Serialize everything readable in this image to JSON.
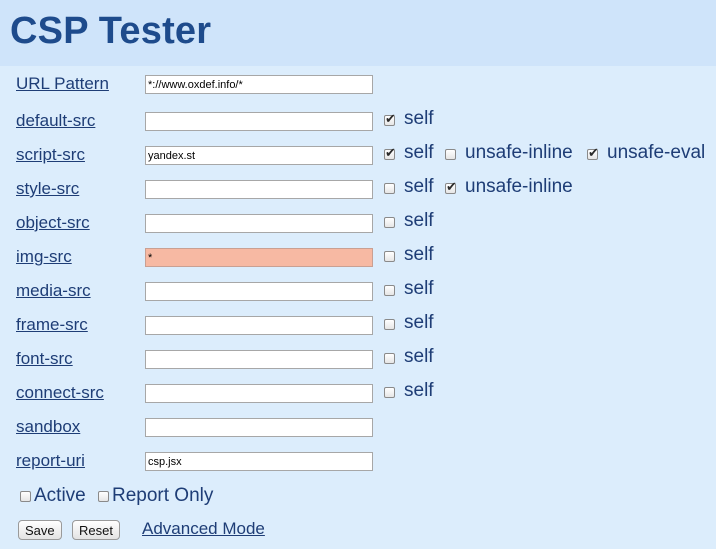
{
  "title": "CSP Tester",
  "rows": [
    {
      "label": "URL Pattern",
      "value": "*://www.oxdef.info/*"
    },
    {
      "label": "default-src",
      "value": "",
      "options": [
        {
          "label": "self",
          "checked": true
        }
      ]
    },
    {
      "label": "script-src",
      "value": "yandex.st",
      "options": [
        {
          "label": "self",
          "checked": true
        },
        {
          "label": "unsafe-inline",
          "checked": false
        },
        {
          "label": "unsafe-eval",
          "checked": true
        }
      ]
    },
    {
      "label": "style-src",
      "value": "",
      "options": [
        {
          "label": "self",
          "checked": false
        },
        {
          "label": "unsafe-inline",
          "checked": true
        }
      ]
    },
    {
      "label": "object-src",
      "value": "",
      "options": [
        {
          "label": "self",
          "checked": false
        }
      ]
    },
    {
      "label": "img-src",
      "value": "*",
      "error": true,
      "options": [
        {
          "label": "self",
          "checked": false
        }
      ]
    },
    {
      "label": "media-src",
      "value": "",
      "options": [
        {
          "label": "self",
          "checked": false
        }
      ]
    },
    {
      "label": "frame-src",
      "value": "",
      "options": [
        {
          "label": "self",
          "checked": false
        }
      ]
    },
    {
      "label": "font-src",
      "value": "",
      "options": [
        {
          "label": "self",
          "checked": false
        }
      ]
    },
    {
      "label": "connect-src",
      "value": "",
      "options": [
        {
          "label": "self",
          "checked": false
        }
      ]
    },
    {
      "label": "sandbox",
      "value": ""
    },
    {
      "label": "report-uri",
      "value": "csp.jsx"
    }
  ],
  "toggles": {
    "active": {
      "label": "Active",
      "checked": false
    },
    "report_only": {
      "label": "Report Only",
      "checked": false
    }
  },
  "buttons": {
    "save": "Save",
    "reset": "Reset"
  },
  "advanced_link": "Advanced Mode",
  "colors": {
    "error_field": "#f7b9a3",
    "title": "#1e4b8c",
    "background": "#dcedfc"
  }
}
